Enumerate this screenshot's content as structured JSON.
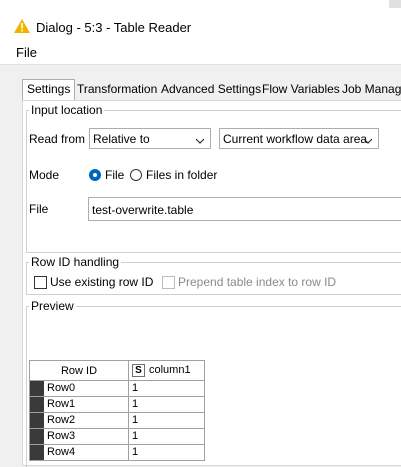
{
  "window": {
    "title": "Dialog - 5:3 - Table Reader",
    "icon": "warning-triangle-icon"
  },
  "menu": {
    "file_label": "File"
  },
  "tabs": [
    {
      "label": "Settings",
      "active": true
    },
    {
      "label": "Transformation"
    },
    {
      "label": "Advanced Settings"
    },
    {
      "label": "Flow Variables"
    },
    {
      "label": "Job Manager"
    }
  ],
  "input_location": {
    "title": "Input location",
    "read_from_label": "Read from",
    "read_from_value": "Relative to",
    "location_value": "Current workflow data area",
    "mode_label": "Mode",
    "mode_options": [
      "File",
      "Files in folder"
    ],
    "mode_selected": "File",
    "file_label": "File",
    "file_value": "test-overwrite.table"
  },
  "row_id_handling": {
    "title": "Row ID handling",
    "use_existing_label": "Use existing row ID",
    "prepend_label": "Prepend table index to row ID"
  },
  "preview": {
    "title": "Preview",
    "columns": [
      "Row ID",
      "column1"
    ],
    "column_type_badge": "S",
    "rows": [
      {
        "id": "Row0",
        "value": "1"
      },
      {
        "id": "Row1",
        "value": "1"
      },
      {
        "id": "Row2",
        "value": "1"
      },
      {
        "id": "Row3",
        "value": "1"
      },
      {
        "id": "Row4",
        "value": "1"
      }
    ]
  },
  "colors": {
    "accent": "#0067c0",
    "warning_icon": "#f0b400"
  }
}
